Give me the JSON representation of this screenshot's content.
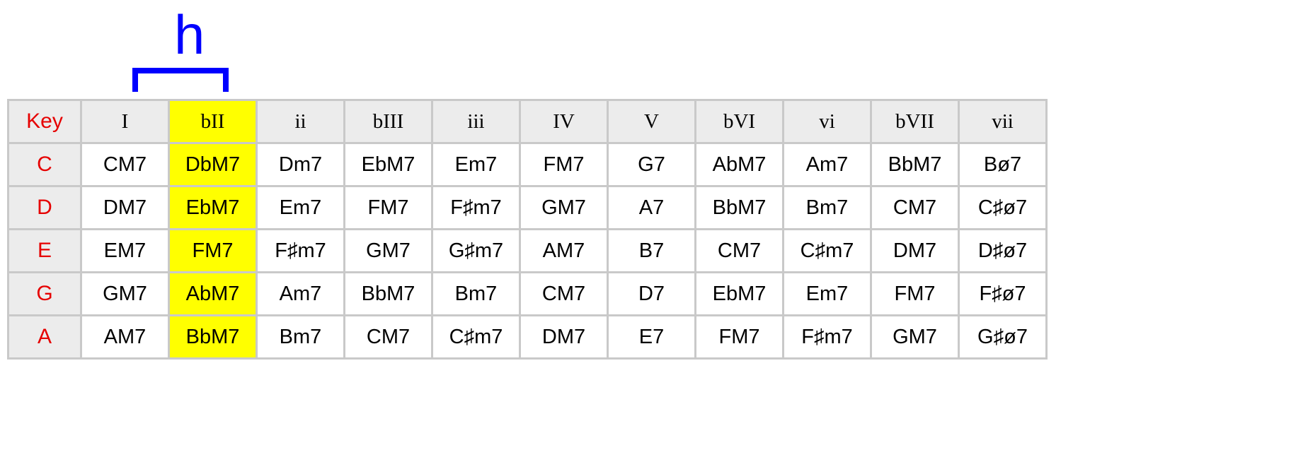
{
  "annotation": {
    "label": "h"
  },
  "headers": {
    "key": "Key",
    "c1": "I",
    "c2": "bII",
    "c3": "ii",
    "c4": "bIII",
    "c5": "iii",
    "c6": "IV",
    "c7": "V",
    "c8": "bVI",
    "c9": "vi",
    "c10": "bVII",
    "c11": "vii"
  },
  "rows": [
    {
      "key": "C",
      "c1": "CM7",
      "c2": "DbM7",
      "c3": "Dm7",
      "c4": "EbM7",
      "c5": "Em7",
      "c6": "FM7",
      "c7": "G7",
      "c8": "AbM7",
      "c9": "Am7",
      "c10": "BbM7",
      "c11": "Bø7"
    },
    {
      "key": "D",
      "c1": "DM7",
      "c2": "EbM7",
      "c3": "Em7",
      "c4": "FM7",
      "c5": "F♯m7",
      "c6": "GM7",
      "c7": "A7",
      "c8": "BbM7",
      "c9": "Bm7",
      "c10": "CM7",
      "c11": "C♯ø7"
    },
    {
      "key": "E",
      "c1": "EM7",
      "c2": "FM7",
      "c3": "F♯m7",
      "c4": "GM7",
      "c5": "G♯m7",
      "c6": "AM7",
      "c7": "B7",
      "c8": "CM7",
      "c9": "C♯m7",
      "c10": "DM7",
      "c11": "D♯ø7"
    },
    {
      "key": "G",
      "c1": "GM7",
      "c2": "AbM7",
      "c3": "Am7",
      "c4": "BbM7",
      "c5": "Bm7",
      "c6": "CM7",
      "c7": "D7",
      "c8": "EbM7",
      "c9": "Em7",
      "c10": "FM7",
      "c11": "F♯ø7"
    },
    {
      "key": "A",
      "c1": "AM7",
      "c2": "BbM7",
      "c3": "Bm7",
      "c4": "CM7",
      "c5": "C♯m7",
      "c6": "DM7",
      "c7": "E7",
      "c8": "FM7",
      "c9": "F♯m7",
      "c10": "GM7",
      "c11": "G♯ø7"
    }
  ]
}
